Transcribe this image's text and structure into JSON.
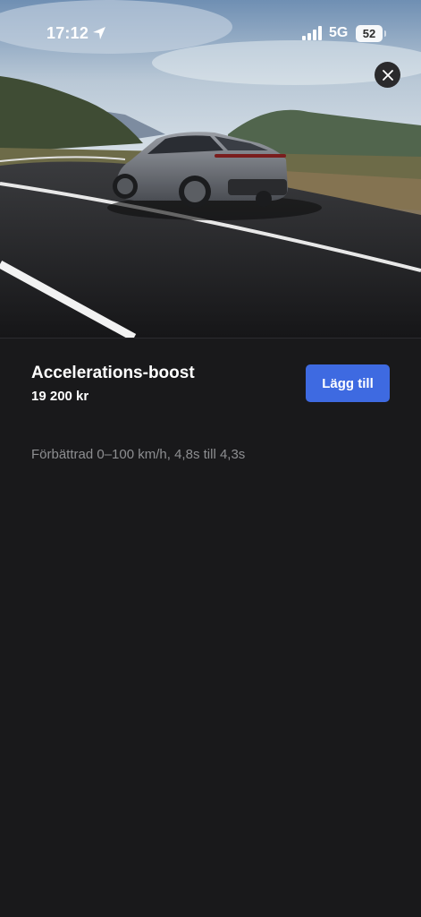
{
  "status_bar": {
    "time": "17:12",
    "network": "5G",
    "battery": "52",
    "icons": [
      "location-arrow-icon",
      "cellular-signal-icon",
      "battery-icon"
    ]
  },
  "hero": {
    "image": "car-on-road-photo",
    "close_icon": "close-icon"
  },
  "feature": {
    "title": "Accelerations-boost",
    "price": "19 200 kr",
    "add_label": "Lägg till",
    "description": "Förbättrad 0–100 km/h, 4,8s till 4,3s"
  },
  "colors": {
    "background": "#19191b",
    "accent": "#3e6ae1",
    "text_primary": "#ffffff",
    "text_secondary": "#8d8e91"
  }
}
